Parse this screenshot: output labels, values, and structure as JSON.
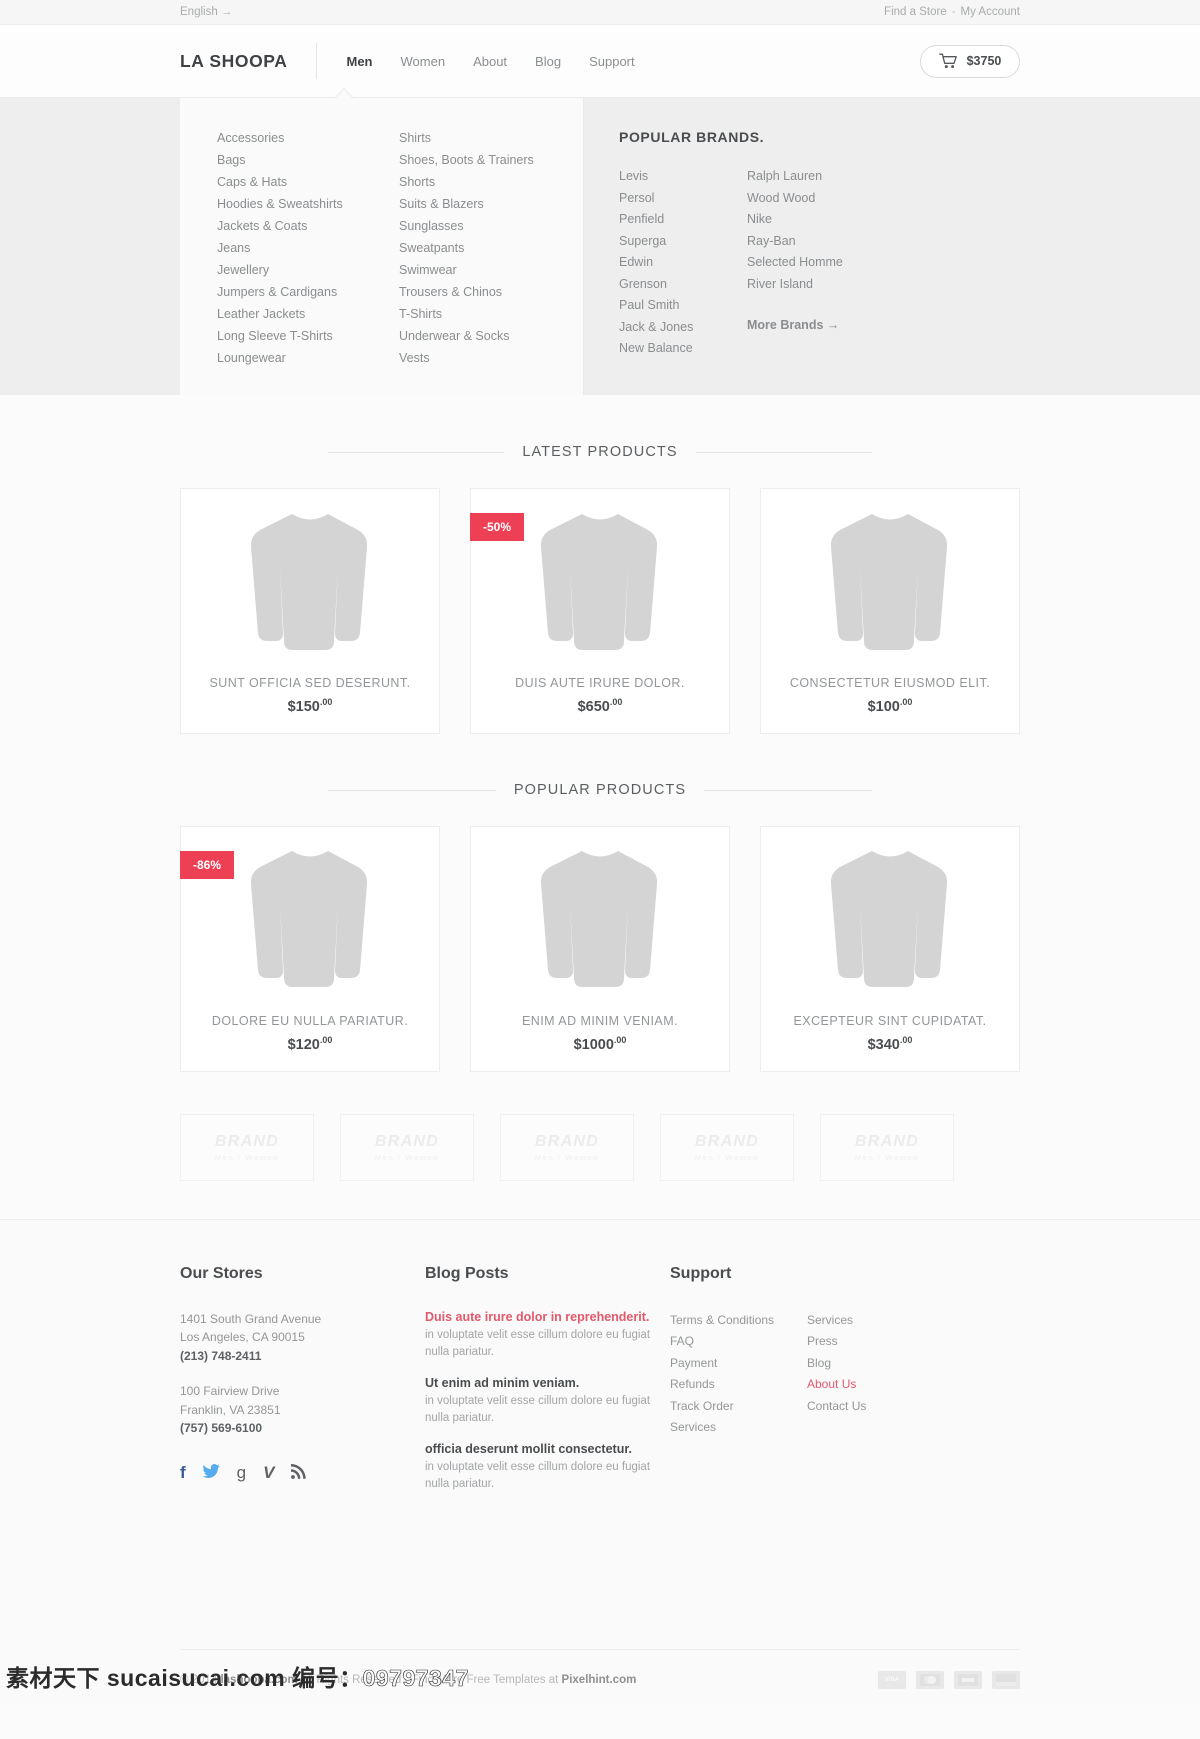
{
  "topbar": {
    "language": "English →",
    "find_store": "Find a Store",
    "separator": "-",
    "my_account": "My Account"
  },
  "header": {
    "logo": "LA SHOOPA",
    "nav": [
      {
        "label": "Men",
        "active": true
      },
      {
        "label": "Women",
        "active": false
      },
      {
        "label": "About",
        "active": false
      },
      {
        "label": "Blog",
        "active": false
      },
      {
        "label": "Support",
        "active": false
      }
    ],
    "cart": {
      "icon": "shopping-cart-icon",
      "total": "$3750"
    }
  },
  "mega_menu": {
    "categories_col1": [
      "Accessories",
      "Bags",
      "Caps & Hats",
      "Hoodies & Sweatshirts",
      "Jackets & Coats",
      "Jeans",
      "Jewellery",
      "Jumpers & Cardigans",
      "Leather Jackets",
      "Long Sleeve T-Shirts",
      "Loungewear"
    ],
    "categories_col2": [
      "Shirts",
      "Shoes, Boots & Trainers",
      "Shorts",
      "Suits & Blazers",
      "Sunglasses",
      "Sweatpants",
      "Swimwear",
      "Trousers & Chinos",
      "T-Shirts",
      "Underwear & Socks",
      "Vests"
    ],
    "brands_title": "POPULAR BRANDS.",
    "brands_col1": [
      "Levis",
      "Persol",
      "Penfield",
      "Superga",
      "Edwin",
      "Grenson",
      "Paul Smith",
      "Jack & Jones",
      "New Balance"
    ],
    "brands_col2": [
      "Ralph Lauren",
      "Wood Wood",
      "Nike",
      "Ray-Ban",
      "Selected Homme",
      "River Island"
    ],
    "more_brands": "More Brands  →"
  },
  "latest": {
    "title": "LATEST PRODUCTS",
    "items": [
      {
        "name": "SUNT OFFICIA SED DESERUNT.",
        "price": "$150",
        "cents": ".00",
        "badge": null
      },
      {
        "name": "DUIS AUTE IRURE DOLOR.",
        "price": "$650",
        "cents": ".00",
        "badge": "-50%"
      },
      {
        "name": "CONSECTETUR EIUSMOD ELIT.",
        "price": "$100",
        "cents": ".00",
        "badge": null
      }
    ]
  },
  "popular": {
    "title": "POPULAR PRODUCTS",
    "items": [
      {
        "name": "DOLORE EU NULLA PARIATUR.",
        "price": "$120",
        "cents": ".00",
        "badge": "-86%"
      },
      {
        "name": "ENIM AD MINIM VENIAM.",
        "price": "$1000",
        "cents": ".00",
        "badge": null
      },
      {
        "name": "EXCEPTEUR SINT CUPIDATAT.",
        "price": "$340",
        "cents": ".00",
        "badge": null
      }
    ]
  },
  "brand_strip": [
    {
      "name": "BRAND",
      "sub": "Men / Women"
    },
    {
      "name": "BRAND",
      "sub": "Men / Women"
    },
    {
      "name": "BRAND",
      "sub": "Men / Women"
    },
    {
      "name": "BRAND",
      "sub": "Men / Women"
    },
    {
      "name": "BRAND",
      "sub": "Men / Women"
    }
  ],
  "footer": {
    "stores": {
      "heading": "Our Stores",
      "locations": [
        {
          "street": "1401 South Grand Avenue",
          "city": "Los Angeles, CA 90015",
          "phone": "(213) 748-2411"
        },
        {
          "street": "100 Fairview Drive",
          "city": "Franklin, VA 23851",
          "phone": "(757) 569-6100"
        }
      ],
      "social": [
        {
          "icon": "facebook-icon",
          "glyph": "f"
        },
        {
          "icon": "twitter-icon",
          "glyph": "🐦"
        },
        {
          "icon": "google-plus-icon",
          "glyph": "g"
        },
        {
          "icon": "vimeo-icon",
          "glyph": "V"
        },
        {
          "icon": "rss-icon",
          "glyph": "≋"
        }
      ]
    },
    "blog": {
      "heading": "Blog Posts",
      "posts": [
        {
          "title": "Duis aute irure dolor in reprehenderit.",
          "excerpt": "in voluptate velit esse cillum dolore eu fugiat nulla pariatur.",
          "highlight": true
        },
        {
          "title": "Ut enim ad minim veniam.",
          "excerpt": "in voluptate velit esse cillum dolore eu fugiat nulla pariatur.",
          "highlight": false
        },
        {
          "title": "officia deserunt mollit consectetur.",
          "excerpt": "in voluptate velit esse cillum dolore eu fugiat nulla pariatur.",
          "highlight": false
        }
      ]
    },
    "support": {
      "heading": "Support",
      "col1": [
        {
          "label": "Terms & Conditions",
          "highlight": false
        },
        {
          "label": "FAQ",
          "highlight": false
        },
        {
          "label": "Payment",
          "highlight": false
        },
        {
          "label": "Refunds",
          "highlight": false
        },
        {
          "label": "Track Order",
          "highlight": false
        },
        {
          "label": "Services",
          "highlight": false
        }
      ],
      "col2": [
        {
          "label": "Services",
          "highlight": false
        },
        {
          "label": "Press",
          "highlight": false
        },
        {
          "label": "Blog",
          "highlight": false
        },
        {
          "label": "About Us",
          "highlight": true
        },
        {
          "label": "Contact Us",
          "highlight": false
        }
      ]
    },
    "copyright_prefix": "© 2014 ",
    "copyright_site": "lashoopa.com",
    "copyright_mid": " All Rights Reserved  -  Find More Free Templates at ",
    "copyright_brand": "Pixelhint.com",
    "payment_cards": [
      "VISA",
      "MASTERCARD",
      "AMEX",
      "DISCOVER"
    ]
  },
  "watermark": {
    "text_cn": "素材天下",
    "site": "sucaisucai.com",
    "label": "编号：",
    "number": "09797347"
  },
  "colors": {
    "accent_red": "#ee4054",
    "link_red": "#e2596c",
    "text_dark": "#4a4d4f",
    "text_muted": "#949698"
  }
}
